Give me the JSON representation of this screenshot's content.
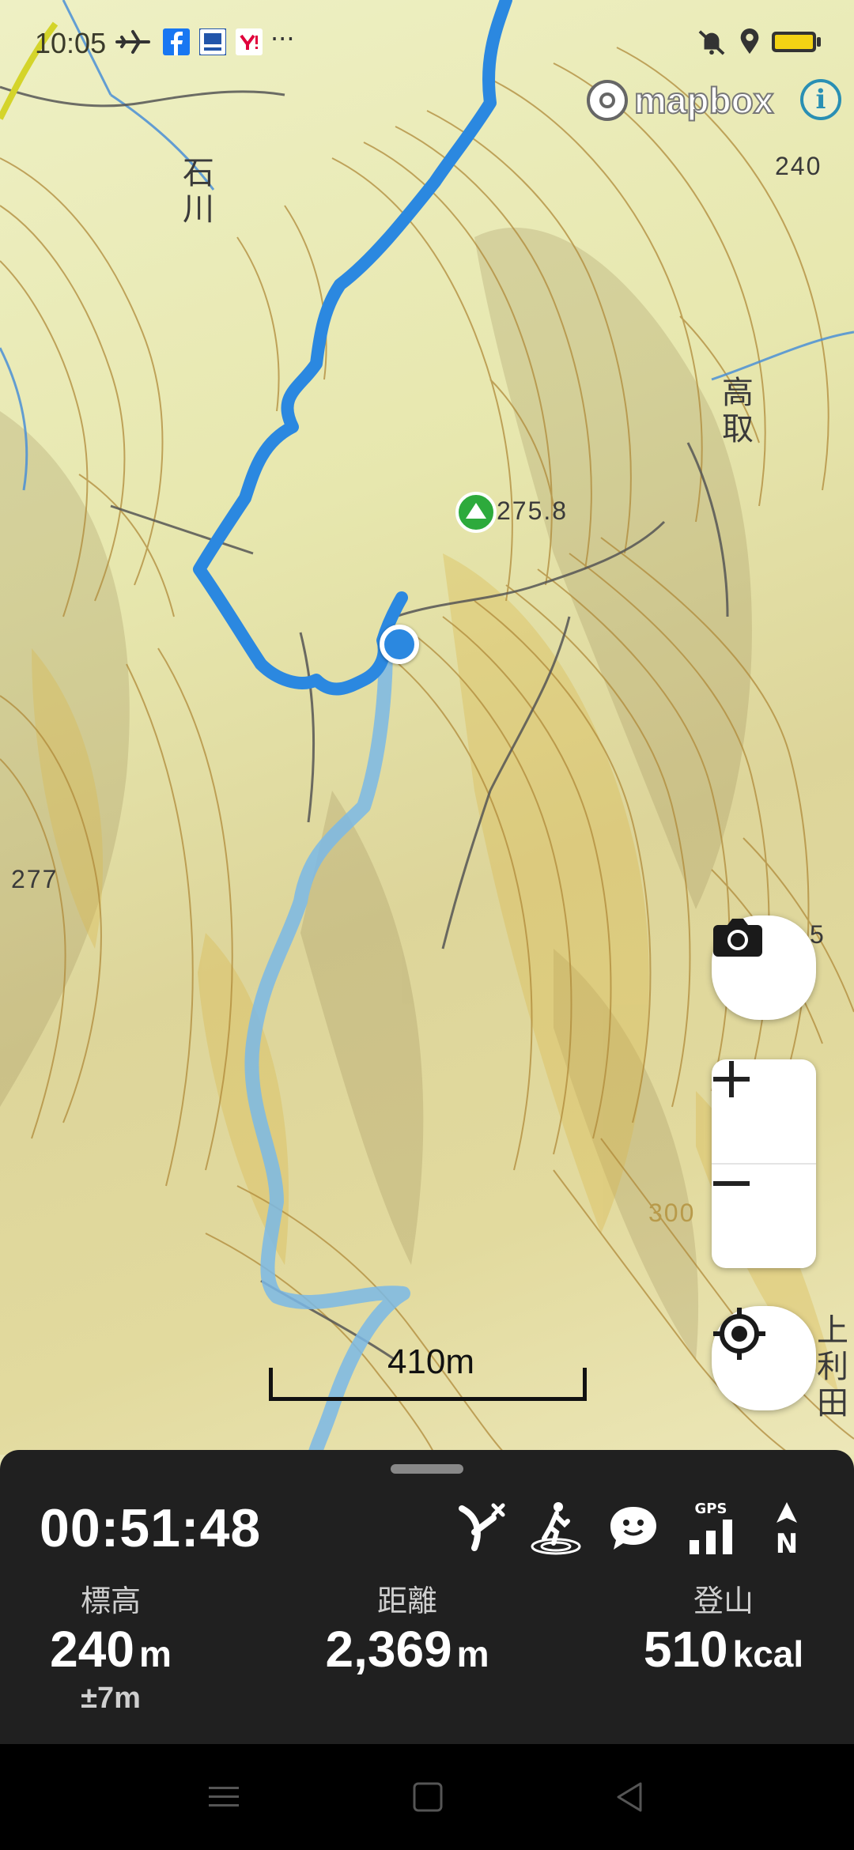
{
  "status_bar": {
    "time": "10:05",
    "icons": [
      "airplane-icon",
      "facebook-icon",
      "app-icon",
      "yahoo-icon",
      "more-icon",
      "vibrate-off-icon",
      "location-icon",
      "battery-icon"
    ],
    "ellipsis": "···"
  },
  "map": {
    "attribution": "mapbox",
    "info_symbol": "i",
    "elevation_labels": [
      "240",
      "275.8",
      "277",
      "300",
      "5"
    ],
    "place_labels": {
      "ishikawa": [
        "石",
        "川"
      ],
      "takatori": [
        "高",
        "取"
      ],
      "kamitoshida": [
        "上",
        "利",
        "田"
      ]
    },
    "scale": "410m",
    "track_color": "#2b88e0",
    "planned_route_color": "#7ab8e6"
  },
  "panel": {
    "elapsed_time": "00:51:48",
    "icons": [
      "off-route-icon",
      "hiker-icon",
      "chat-icon",
      "gps-signal-icon",
      "north-arrow-icon"
    ],
    "gps_label": "GPS",
    "north_label": "N",
    "stats": [
      {
        "label": "標高",
        "value": "240",
        "unit": "m",
        "sub": "±7m"
      },
      {
        "label": "距離",
        "value": "2,369",
        "unit": "m",
        "sub": ""
      },
      {
        "label": "登山",
        "value": "510",
        "unit": "kcal",
        "sub": ""
      }
    ]
  },
  "nav_bar": {
    "buttons": [
      "menu-icon",
      "home-icon",
      "back-icon"
    ]
  }
}
